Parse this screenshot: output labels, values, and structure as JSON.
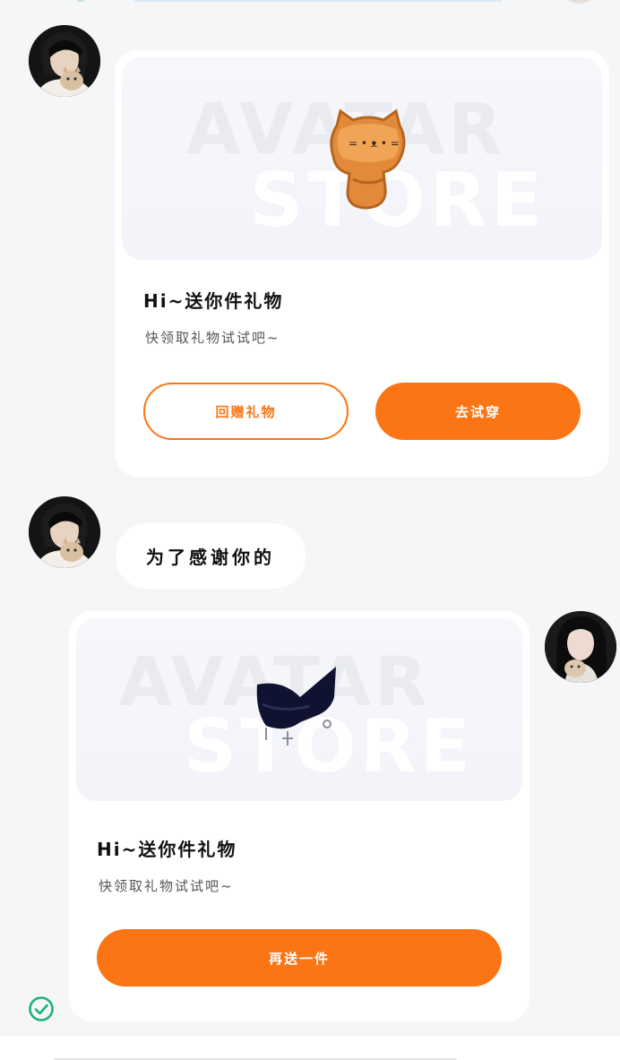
{
  "messages": [
    {
      "sender": "other",
      "type": "gift_card",
      "watermark": [
        "AVATAR",
        "STORE"
      ],
      "item": "cat-cookie",
      "title": "Hi~送你件礼物",
      "subtitle": "快领取礼物试试吧~",
      "buttons": {
        "secondary": "回赠礼物",
        "primary": "去试穿"
      }
    },
    {
      "sender": "other",
      "type": "text",
      "text": "为了感谢你的"
    },
    {
      "sender": "self",
      "type": "gift_card",
      "watermark": [
        "AVATAR",
        "STORE"
      ],
      "item": "black-bow-choker",
      "title": "Hi~送你件礼物",
      "subtitle": "快领取礼物试试吧~",
      "buttons": {
        "primary": "再送一件"
      },
      "status_icon": "check-circle-icon"
    }
  ],
  "colors": {
    "accent": "#fb7515",
    "background": "#f5f6f8",
    "status_ok": "#1bb27a"
  }
}
